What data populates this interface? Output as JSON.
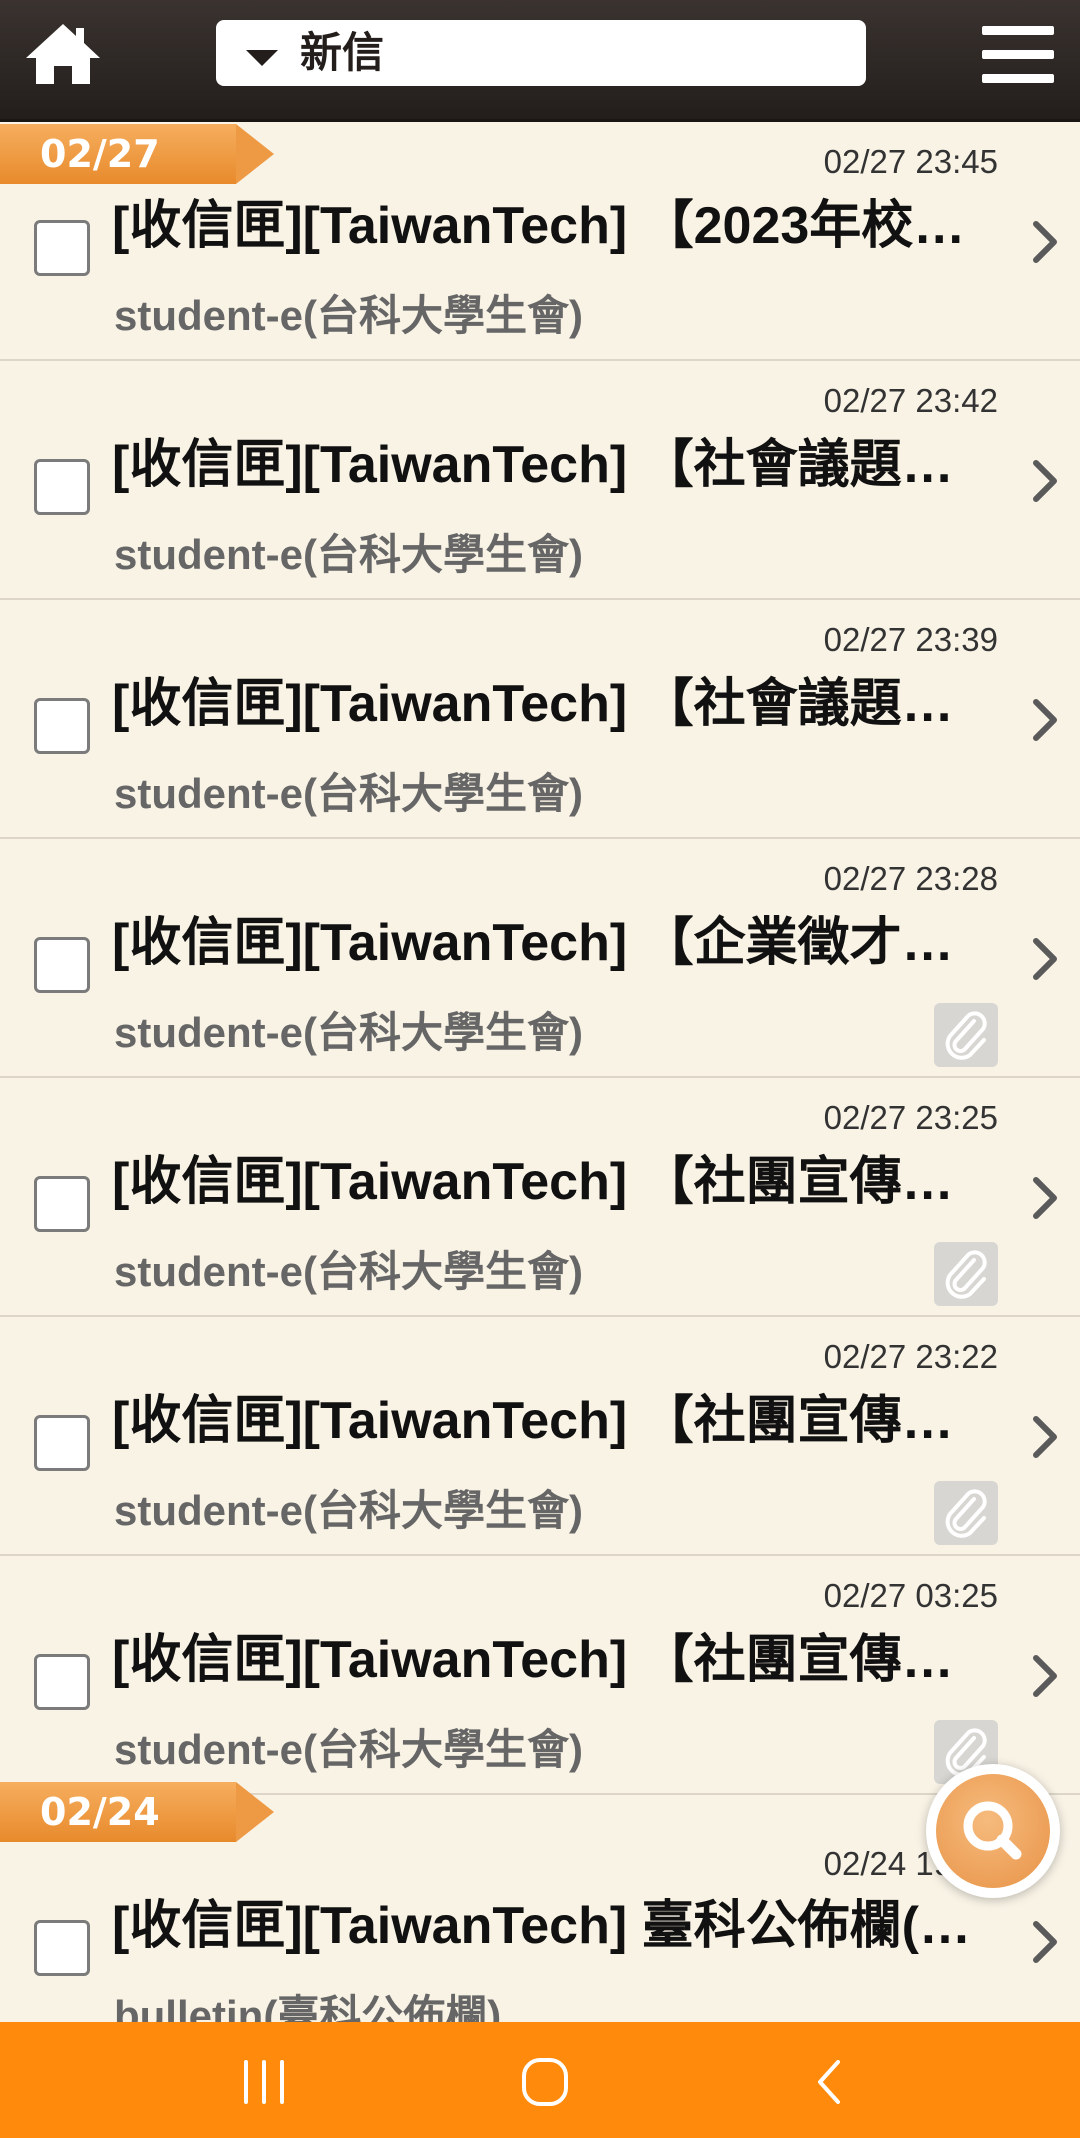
{
  "header": {
    "folder_label": "新信",
    "home_icon": "home-icon",
    "menu_icon": "hamburger-menu-icon"
  },
  "groups": [
    {
      "date": "02/27",
      "mails": [
        {
          "time": "02/27 23:45",
          "subject": "[收信匣][TaiwanTech] 【2023年校…",
          "sender": "student-e(台科大學生會)",
          "attachment": false
        },
        {
          "time": "02/27 23:42",
          "subject": "[收信匣][TaiwanTech] 【社會議題…",
          "sender": "student-e(台科大學生會)",
          "attachment": false
        },
        {
          "time": "02/27 23:39",
          "subject": "[收信匣][TaiwanTech] 【社會議題…",
          "sender": "student-e(台科大學生會)",
          "attachment": false
        },
        {
          "time": "02/27 23:28",
          "subject": "[收信匣][TaiwanTech] 【企業徵才…",
          "sender": "student-e(台科大學生會)",
          "attachment": true
        },
        {
          "time": "02/27 23:25",
          "subject": "[收信匣][TaiwanTech] 【社團宣傳…",
          "sender": "student-e(台科大學生會)",
          "attachment": true
        },
        {
          "time": "02/27 23:22",
          "subject": "[收信匣][TaiwanTech] 【社團宣傳…",
          "sender": "student-e(台科大學生會)",
          "attachment": true
        },
        {
          "time": "02/27 03:25",
          "subject": "[收信匣][TaiwanTech] 【社團宣傳…",
          "sender": "student-e(台科大學生會)",
          "attachment": true
        }
      ]
    },
    {
      "date": "02/24",
      "mails": [
        {
          "time": "02/24 19:00",
          "subject": "[收信匣][TaiwanTech] 臺科公佈欄(…",
          "sender": "bulletin(臺科公佈欄)",
          "attachment": false
        }
      ]
    }
  ],
  "colors": {
    "header_bg": "#231e1c",
    "list_bg": "#f9f3e6",
    "accent_orange": "#ff8a0b",
    "date_tag": "#ee9a45"
  },
  "icons": {
    "search_fab": "search-icon",
    "attachment": "paperclip-icon",
    "chevron": "chevron-right-icon",
    "nav_recents": "recents-icon",
    "nav_home": "home-circle-icon",
    "nav_back": "back-icon"
  }
}
